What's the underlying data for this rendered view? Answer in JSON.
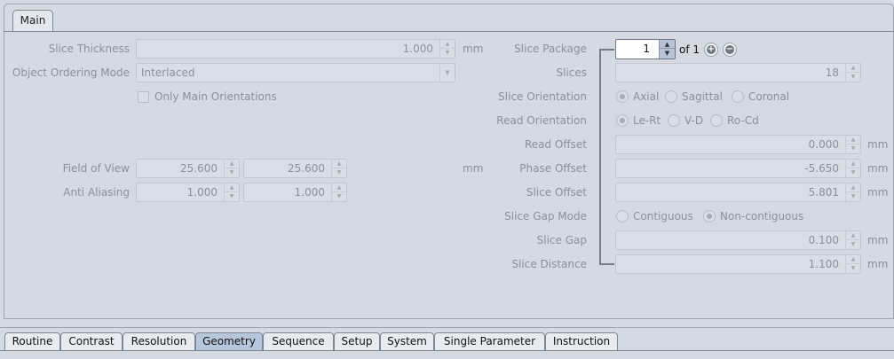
{
  "top_tab": "Main",
  "left": {
    "slice_thickness": {
      "label": "Slice Thickness",
      "value": "1.000",
      "unit": "mm"
    },
    "object_ordering": {
      "label": "Object Ordering Mode",
      "value": "Interlaced"
    },
    "only_main": {
      "label": "Only Main Orientations",
      "checked": false
    },
    "field_of_view": {
      "label": "Field of View",
      "value1": "25.600",
      "value2": "25.600",
      "unit": "mm"
    },
    "anti_aliasing": {
      "label": "Anti Aliasing",
      "value1": "1.000",
      "value2": "1.000"
    }
  },
  "right": {
    "slice_package": {
      "label": "Slice Package",
      "value": "1",
      "of_text": "of 1"
    },
    "slices": {
      "label": "Slices",
      "value": "18"
    },
    "slice_orientation": {
      "label": "Slice Orientation",
      "options": [
        "Axial",
        "Sagittal",
        "Coronal"
      ],
      "selected": "Axial"
    },
    "read_orientation": {
      "label": "Read Orientation",
      "options": [
        "Le-Rt",
        "V-D",
        "Ro-Cd"
      ],
      "selected": "Le-Rt"
    },
    "read_offset": {
      "label": "Read Offset",
      "value": "0.000",
      "unit": "mm"
    },
    "phase_offset": {
      "label": "Phase Offset",
      "value": "-5.650",
      "unit": "mm"
    },
    "slice_offset": {
      "label": "Slice Offset",
      "value": "5.801",
      "unit": "mm"
    },
    "slice_gap_mode": {
      "label": "Slice Gap Mode",
      "options": [
        "Contiguous",
        "Non-contiguous"
      ],
      "selected": "Non-contiguous"
    },
    "slice_gap": {
      "label": "Slice Gap",
      "value": "0.100",
      "unit": "mm"
    },
    "slice_distance": {
      "label": "Slice Distance",
      "value": "1.100",
      "unit": "mm"
    }
  },
  "icons": {
    "spin_up": "spin-up-icon",
    "spin_down": "spin-down-icon",
    "add": "plus-circle-icon",
    "remove": "minus-circle-icon"
  },
  "bottom_tabs": [
    "Routine",
    "Contrast",
    "Resolution",
    "Geometry",
    "Sequence",
    "Setup",
    "System",
    "Single Parameter",
    "Instruction"
  ],
  "active_bottom_tab": "Geometry",
  "colors": {
    "background": "#d4d9e2",
    "active_tab": "#b5c6dd",
    "disabled_text": "#8b9099"
  }
}
